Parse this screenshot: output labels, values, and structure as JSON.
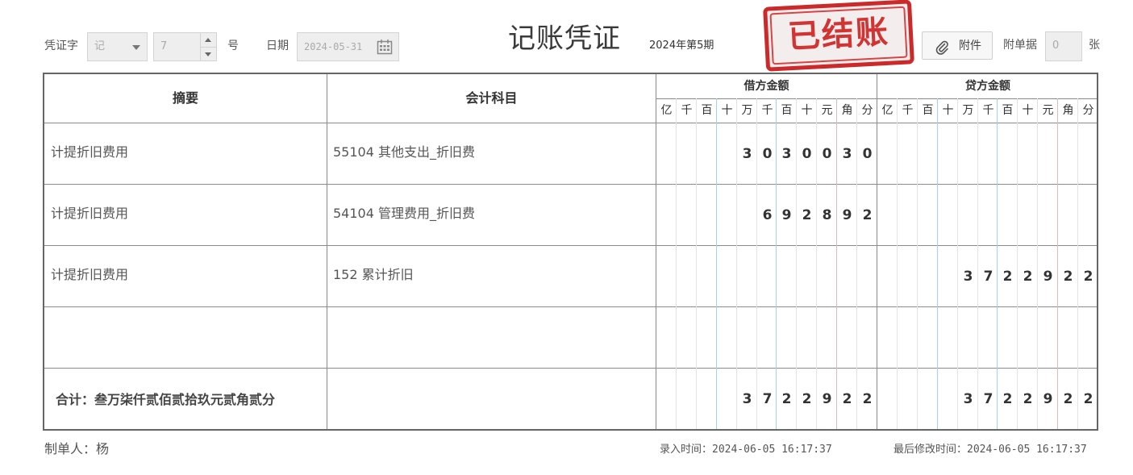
{
  "header": {
    "voucher_word_label": "凭证字",
    "voucher_word_value": "记",
    "number_value": "7",
    "number_suffix": "号",
    "date_label": "日期",
    "date_value": "2024-05-31",
    "title": "记账凭证",
    "period": "2024年第5期",
    "stamp": "已结账",
    "attachment_button": "附件",
    "attached_docs_label": "附单据",
    "attached_docs_value": "0",
    "attached_docs_suffix": "张"
  },
  "table": {
    "col_summary": "摘要",
    "col_account": "会计科目",
    "col_debit": "借方金额",
    "col_credit": "贷方金额",
    "units": [
      "亿",
      "千",
      "百",
      "十",
      "万",
      "千",
      "百",
      "十",
      "元",
      "角",
      "分"
    ],
    "rows": [
      {
        "summary": "计提折旧费用",
        "account": "55104 其他支出_折旧费",
        "debit": "3030030",
        "credit": ""
      },
      {
        "summary": "计提折旧费用",
        "account": "54104 管理费用_折旧费",
        "debit": "692892",
        "credit": ""
      },
      {
        "summary": "计提折旧费用",
        "account": "152 累计折旧",
        "debit": "",
        "credit": "3722922"
      },
      {
        "summary": "",
        "account": "",
        "debit": "",
        "credit": ""
      }
    ],
    "total": {
      "label": "合计：叁万柒仟贰佰贰拾玖元贰角贰分",
      "debit": "3722922",
      "credit": "3722922"
    }
  },
  "footer": {
    "preparer": "制单人：杨",
    "entry_time": "录入时间：2024-06-05 16:17:37",
    "modified_time": "最后修改时间：2024-06-05 16:17:37"
  }
}
